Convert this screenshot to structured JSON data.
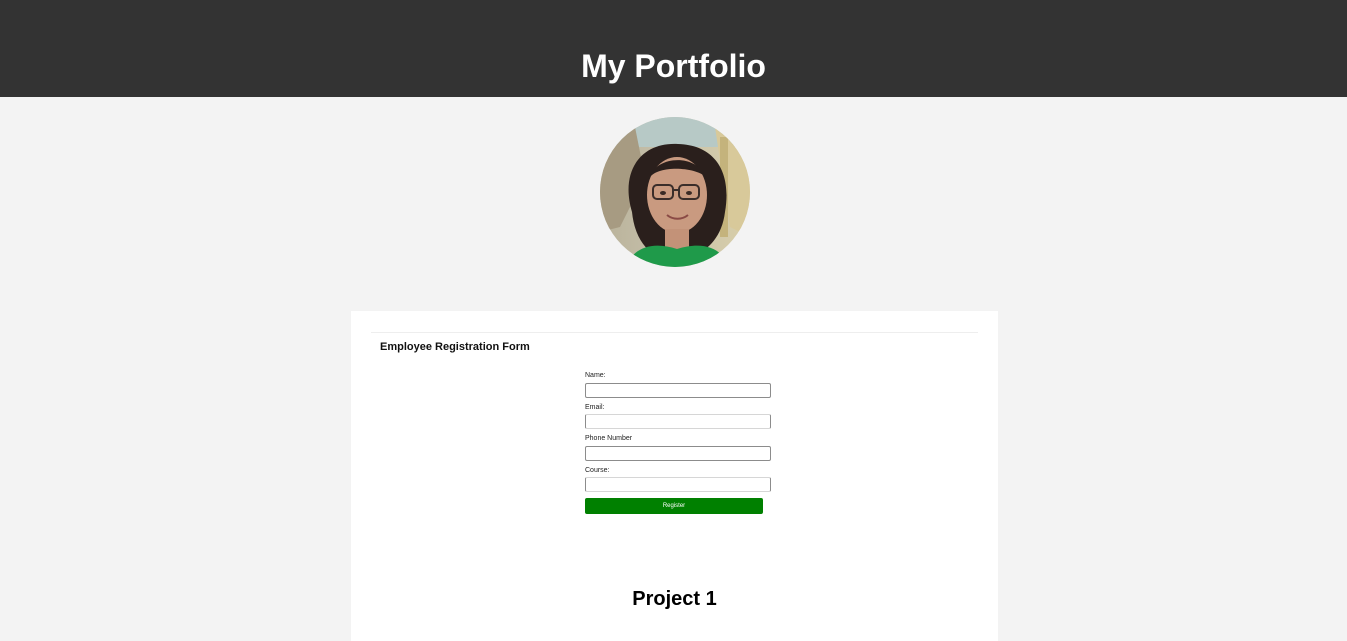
{
  "header": {
    "title": "My Portfolio",
    "background": "#333333"
  },
  "profile": {
    "image_icon": "profile-photo"
  },
  "project_card": {
    "form": {
      "heading": "Employee Registration Form",
      "fields": [
        {
          "label": "Name:",
          "value": ""
        },
        {
          "label": "Email:",
          "value": ""
        },
        {
          "label": "Phone Number",
          "value": ""
        },
        {
          "label": "Course:",
          "value": ""
        }
      ],
      "submit_label": "Register",
      "submit_color": "#008000"
    },
    "project_title": "Project 1"
  },
  "colors": {
    "page_background": "#f3f3f3",
    "card_background": "#ffffff"
  }
}
